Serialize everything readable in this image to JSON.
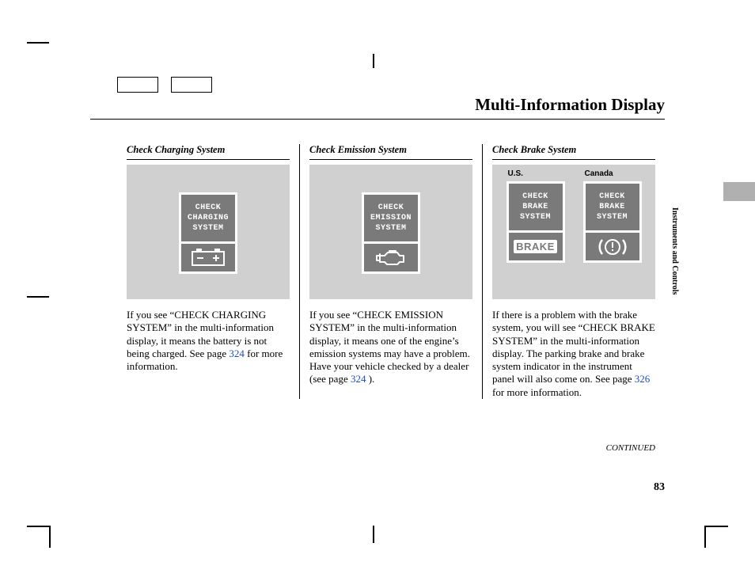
{
  "page_title": "Multi-Information Display",
  "side_label": "Instruments and Controls",
  "continued": "CONTINUED",
  "page_number": "83",
  "col1": {
    "heading": "Check Charging System",
    "msg_l1": "CHECK",
    "msg_l2": "CHARGING",
    "msg_l3": "SYSTEM",
    "body_pre": "If you see “CHECK CHARGING SYSTEM” in the multi-information display, it means the battery is not being charged. See page ",
    "link": "324",
    "body_post": " for more information."
  },
  "col2": {
    "heading": "Check Emission System",
    "msg_l1": "CHECK",
    "msg_l2": "EMISSION",
    "msg_l3": "SYSTEM",
    "body_pre": "If you see “CHECK EMISSION SYSTEM” in the multi-information display, it means one of the engine’s emission systems may have a problem. Have your vehicle checked by a dealer (see page ",
    "link": "324",
    "body_post": " )."
  },
  "col3": {
    "heading": "Check Brake System",
    "us_label": "U.S.",
    "ca_label": "Canada",
    "msg_l1": "CHECK",
    "msg_l2": "BRAKE",
    "msg_l3": "SYSTEM",
    "brake_word": "BRAKE",
    "body_pre": "If there is a problem with the brake system, you will see “CHECK BRAKE SYSTEM” in the multi-information display. The parking brake and brake system indicator in the instrument panel will also come on. See page ",
    "link": "326",
    "body_post": " for more information."
  }
}
